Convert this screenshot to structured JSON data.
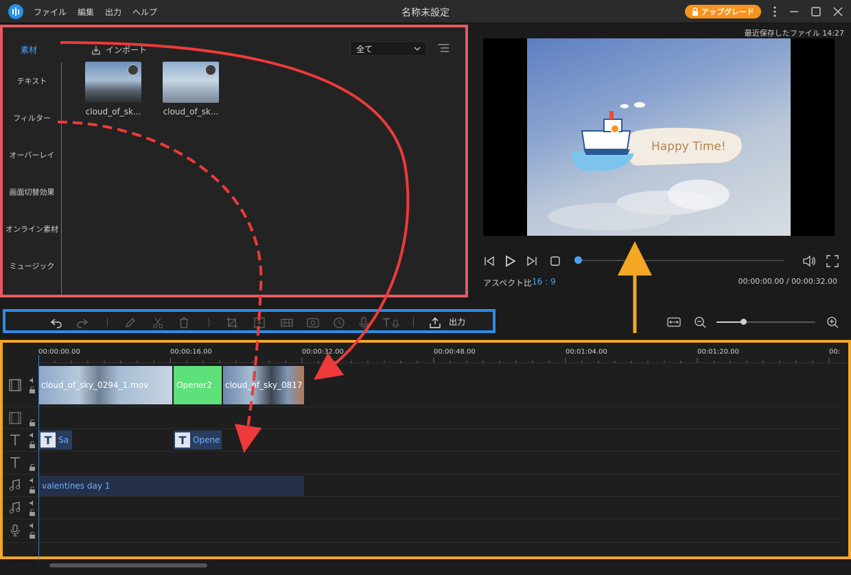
{
  "titlebar": {
    "menu": [
      "ファイル",
      "編集",
      "出力",
      "ヘルプ"
    ],
    "title": "名称未設定",
    "upgrade_label": "アップグレード"
  },
  "library": {
    "active_tab": "素材",
    "tabs": [
      "テキスト",
      "フィルター",
      "オーバーレイ",
      "画面切替効果",
      "オンライン素材",
      "ミュージック"
    ],
    "import_label": "インポート",
    "filter_value": "全て",
    "media": [
      {
        "label": "cloud_of_sk..."
      },
      {
        "label": "cloud_of_sk..."
      }
    ]
  },
  "preview": {
    "saved_info": "最近保存したファイル 14:27",
    "overlay_text": "Happy Time!",
    "aspect_label": "アスペクト比",
    "aspect_value": "16 : 9",
    "timecode": "00:00:00.00 / 00:00:32.00"
  },
  "toolbar": {
    "export_label": "出力"
  },
  "timeline": {
    "ruler": [
      "00:00:00.00",
      "00:00:16.00",
      "00:00:32.00",
      "00:00:48.00",
      "00:01:04.00",
      "00:01:20.00",
      "00:"
    ],
    "video_clips": [
      {
        "label": "cloud_of_sky_0294_1.mov"
      },
      {
        "label": "Opener2"
      },
      {
        "label": "cloud_of_sky_0817"
      }
    ],
    "title_clips": [
      {
        "label": "Sa"
      },
      {
        "label": "Opene"
      }
    ],
    "audio_clip": "valentines day 1"
  },
  "colors": {
    "library_border": "#e8585e",
    "toolbar_border": "#2e8be8",
    "timeline_border": "#f5a623",
    "accent": "#4aa3ff",
    "upgrade": "#f7931e",
    "opener_clip": "#5ee07a"
  },
  "icons": [
    "app-logo-icon",
    "lock-icon",
    "more-icon",
    "minimize-icon",
    "maximize-icon",
    "close-icon",
    "import-icon",
    "chevron-down-icon",
    "list-view-icon",
    "prev-frame-icon",
    "play-icon",
    "next-frame-icon",
    "stop-icon",
    "volume-icon",
    "fullscreen-icon",
    "undo-icon",
    "redo-icon",
    "edit-icon",
    "cut-icon",
    "delete-icon",
    "crop-icon",
    "zoom-icon",
    "mosaic-icon",
    "freeze-icon",
    "duration-icon",
    "voiceover-icon",
    "text-to-speech-icon",
    "export-icon",
    "fit-icon",
    "zoom-out-icon",
    "zoom-in-icon",
    "film-track-icon",
    "text-track-icon",
    "music-track-icon",
    "mic-track-icon"
  ]
}
